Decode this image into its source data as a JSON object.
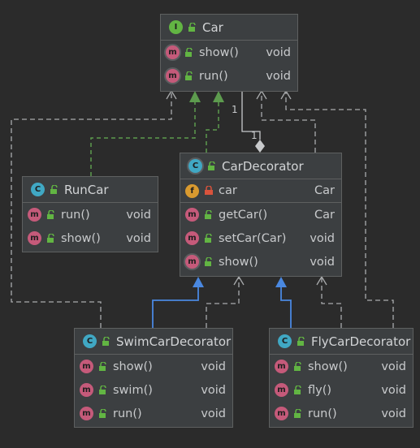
{
  "classes": {
    "car": {
      "name": "Car",
      "kind": "I",
      "members": [
        {
          "kind": "m",
          "visibility": "public",
          "name": "show()",
          "type": "void"
        },
        {
          "kind": "m",
          "visibility": "public",
          "name": "run()",
          "type": "void"
        }
      ]
    },
    "runcar": {
      "name": "RunCar",
      "kind": "C",
      "members": [
        {
          "kind": "m",
          "visibility": "public",
          "name": "run()",
          "type": "void"
        },
        {
          "kind": "m",
          "visibility": "public",
          "name": "show()",
          "type": "void"
        }
      ]
    },
    "cardecorator": {
      "name": "CarDecorator",
      "kind": "C",
      "members": [
        {
          "kind": "f",
          "visibility": "private",
          "name": "car",
          "type": "Car"
        },
        {
          "kind": "m",
          "visibility": "public",
          "name": "getCar()",
          "type": "Car"
        },
        {
          "kind": "m",
          "visibility": "public",
          "name": "setCar(Car)",
          "type": "void"
        },
        {
          "kind": "m",
          "visibility": "public",
          "name": "show()",
          "type": "void"
        }
      ]
    },
    "swimcardecorator": {
      "name": "SwimCarDecorator",
      "kind": "C",
      "members": [
        {
          "kind": "m",
          "visibility": "public",
          "name": "show()",
          "type": "void"
        },
        {
          "kind": "m",
          "visibility": "public",
          "name": "swim()",
          "type": "void"
        },
        {
          "kind": "m",
          "visibility": "public",
          "name": "run()",
          "type": "void"
        }
      ]
    },
    "flycardecorator": {
      "name": "FlyCarDecorator",
      "kind": "C",
      "members": [
        {
          "kind": "m",
          "visibility": "public",
          "name": "show()",
          "type": "void"
        },
        {
          "kind": "m",
          "visibility": "public",
          "name": "fly()",
          "type": "void"
        },
        {
          "kind": "m",
          "visibility": "public",
          "name": "run()",
          "type": "void"
        }
      ]
    }
  },
  "multiplicity": {
    "car_end": "1",
    "decorator_end": "1"
  },
  "colors": {
    "implements": "#5d9b4e",
    "extends": "#4a88e0",
    "dependency": "#a9abad",
    "aggregation": "#c8cacc"
  }
}
